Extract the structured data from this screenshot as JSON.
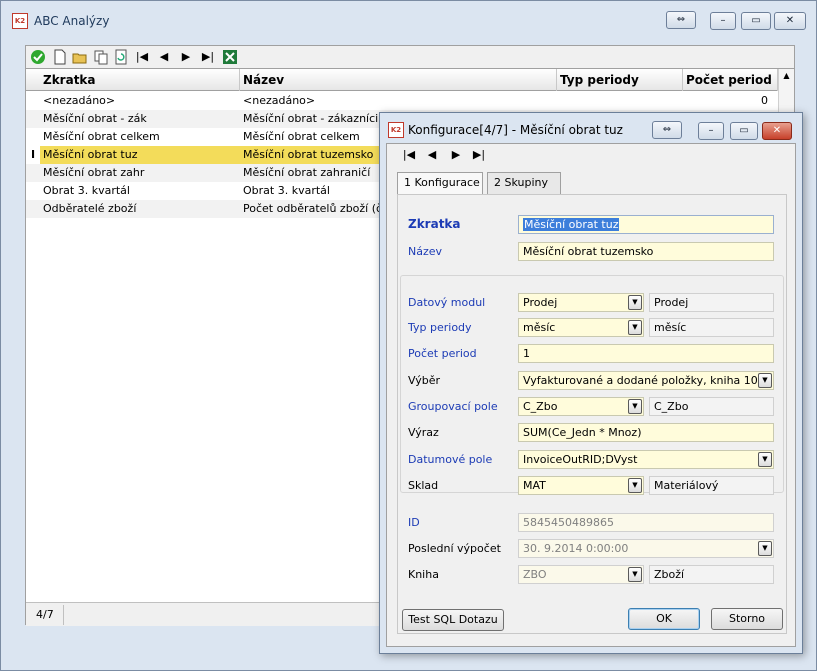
{
  "main_window": {
    "title": "ABC Analýzy"
  },
  "grid": {
    "columns": [
      "Zkratka",
      "Název",
      "Typ periody",
      "Počet period"
    ],
    "rows": [
      {
        "zkratka": "<nezadáno>",
        "nazev": "<nezadáno>",
        "pocet": "0"
      },
      {
        "zkratka": "Měsíční obrat - zák",
        "nazev": "Měsíční obrat - zákazníci"
      },
      {
        "zkratka": "Měsíční obrat celkem",
        "nazev": "Měsíční obrat celkem"
      },
      {
        "zkratka": "Měsíční obrat tuz",
        "nazev": "Měsíční obrat tuzemsko",
        "selected": true
      },
      {
        "zkratka": "Měsíční obrat zahr",
        "nazev": "Měsíční obrat zahraničí"
      },
      {
        "zkratka": "Obrat 3. kvartál",
        "nazev": "Obrat 3. kvartál"
      },
      {
        "zkratka": "Odběratelé zboží",
        "nazev": "Počet odběratelů zboží (čtvr"
      }
    ],
    "selected_row_color": "#f3dc5a",
    "row_indicator": "I"
  },
  "status": {
    "position": "4/7"
  },
  "dialog": {
    "title": "Konfigurace[4/7] - Měsíční obrat tuz",
    "tabs": [
      "1 Konfigurace",
      "2 Skupiny"
    ],
    "fields": {
      "zkratka": {
        "label": "Zkratka",
        "value": "Měsíční obrat tuz"
      },
      "nazev": {
        "label": "Název",
        "value": "Měsíční obrat tuzemsko"
      },
      "datovy_modul": {
        "label": "Datový modul",
        "value": "Prodej",
        "desc": "Prodej"
      },
      "typ_periody": {
        "label": "Typ periody",
        "value": "měsíc",
        "desc": "měsíc"
      },
      "pocet_period": {
        "label": "Počet period",
        "value": "1"
      },
      "vyber": {
        "label": "Výběr",
        "value": "Vyfakturované a dodané položky, kniha 10"
      },
      "groupovaci_pole": {
        "label": "Groupovací pole",
        "value": "C_Zbo",
        "desc": "C_Zbo"
      },
      "vyraz": {
        "label": "Výraz",
        "value": "SUM(Ce_Jedn * Mnoz)"
      },
      "datumove_pole": {
        "label": "Datumové pole",
        "value": "InvoiceOutRID;DVyst"
      },
      "sklad": {
        "label": "Sklad",
        "value": "MAT",
        "desc": "Materiálový"
      },
      "id": {
        "label": "ID",
        "value": "5845450489865"
      },
      "posledni_vypocet": {
        "label": "Poslední výpočet",
        "value": "30. 9.2014  0:00:00"
      },
      "kniha": {
        "label": "Kniha",
        "value": "ZBO",
        "desc": "Zboží"
      }
    },
    "buttons": {
      "test_sql": "Test SQL Dotazu",
      "ok": "OK",
      "cancel": "Storno"
    }
  },
  "colors": {
    "label_blue": "#1c3bb5",
    "field_yellow": "#fffcdb",
    "window_frame": "#dbe5f1"
  }
}
